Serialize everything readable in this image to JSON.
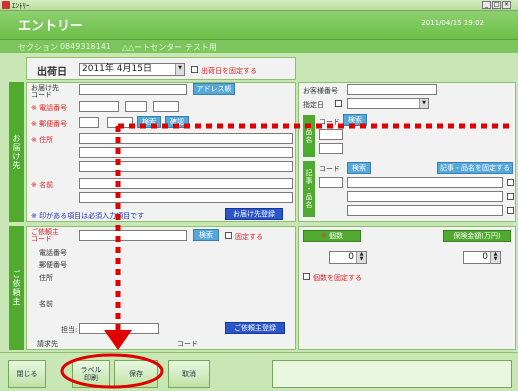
{
  "window": {
    "title": "ｴﾝﾄﾘｰ",
    "minimize": "_",
    "maximize": "□",
    "close": "×"
  },
  "header": {
    "title": "エントリー",
    "datetime": "2011/04/15 19:02"
  },
  "section": {
    "label": "セクション",
    "code": "0849318141",
    "name": "△△ートセンター テスト用"
  },
  "ship_date": {
    "label": "出荷日",
    "value": "2011年 4月15日",
    "fix_label": "出荷日を固定する"
  },
  "delivery": {
    "vertical_label": "お届け先",
    "code_label": "お届け先\nコード",
    "address_book_button": "アドレス帳",
    "phone_label": "※ 電話番号",
    "postal_label": "※ 郵便番号",
    "search_button": "検索",
    "confirm_button": "確認",
    "address_label": "※ 住所",
    "name_label": "※ 名前",
    "required_note": "※ 印がある項目は必須入力項目です",
    "register_button": "お届け先登録"
  },
  "customer": {
    "code_label": "お客様番号",
    "designation_label": "指定日",
    "item_vertical_label": "品名",
    "item_code_label": "コード",
    "item_search_button": "検索",
    "article_vertical_label": "記事・品名",
    "article_code_label": "コード",
    "article_search_button": "検索",
    "article_fix_button": "記事・品名を固定する"
  },
  "requester": {
    "vertical_label": "ご依頼主",
    "code_label": "ご依頼主\nコード",
    "search_button": "検索",
    "fix_label": "固定する",
    "phone_label": "電話番号",
    "postal_label": "郵便番号",
    "address_label": "住所",
    "name_label": "名前",
    "person_label": "担当:",
    "register_button": "ご依頼主登録",
    "bill_label": "請求先",
    "code2_label": "コード"
  },
  "count": {
    "pieces_label": "個数",
    "pieces_value": "0",
    "insurance_label": "保険金額(万円)",
    "insurance_value": "0",
    "fix_label": "個数を固定する"
  },
  "footer": {
    "close_button": "閉じる",
    "label_print_button": "ラベル\n印刷",
    "save_button": "保存",
    "cancel_button": "取消"
  }
}
